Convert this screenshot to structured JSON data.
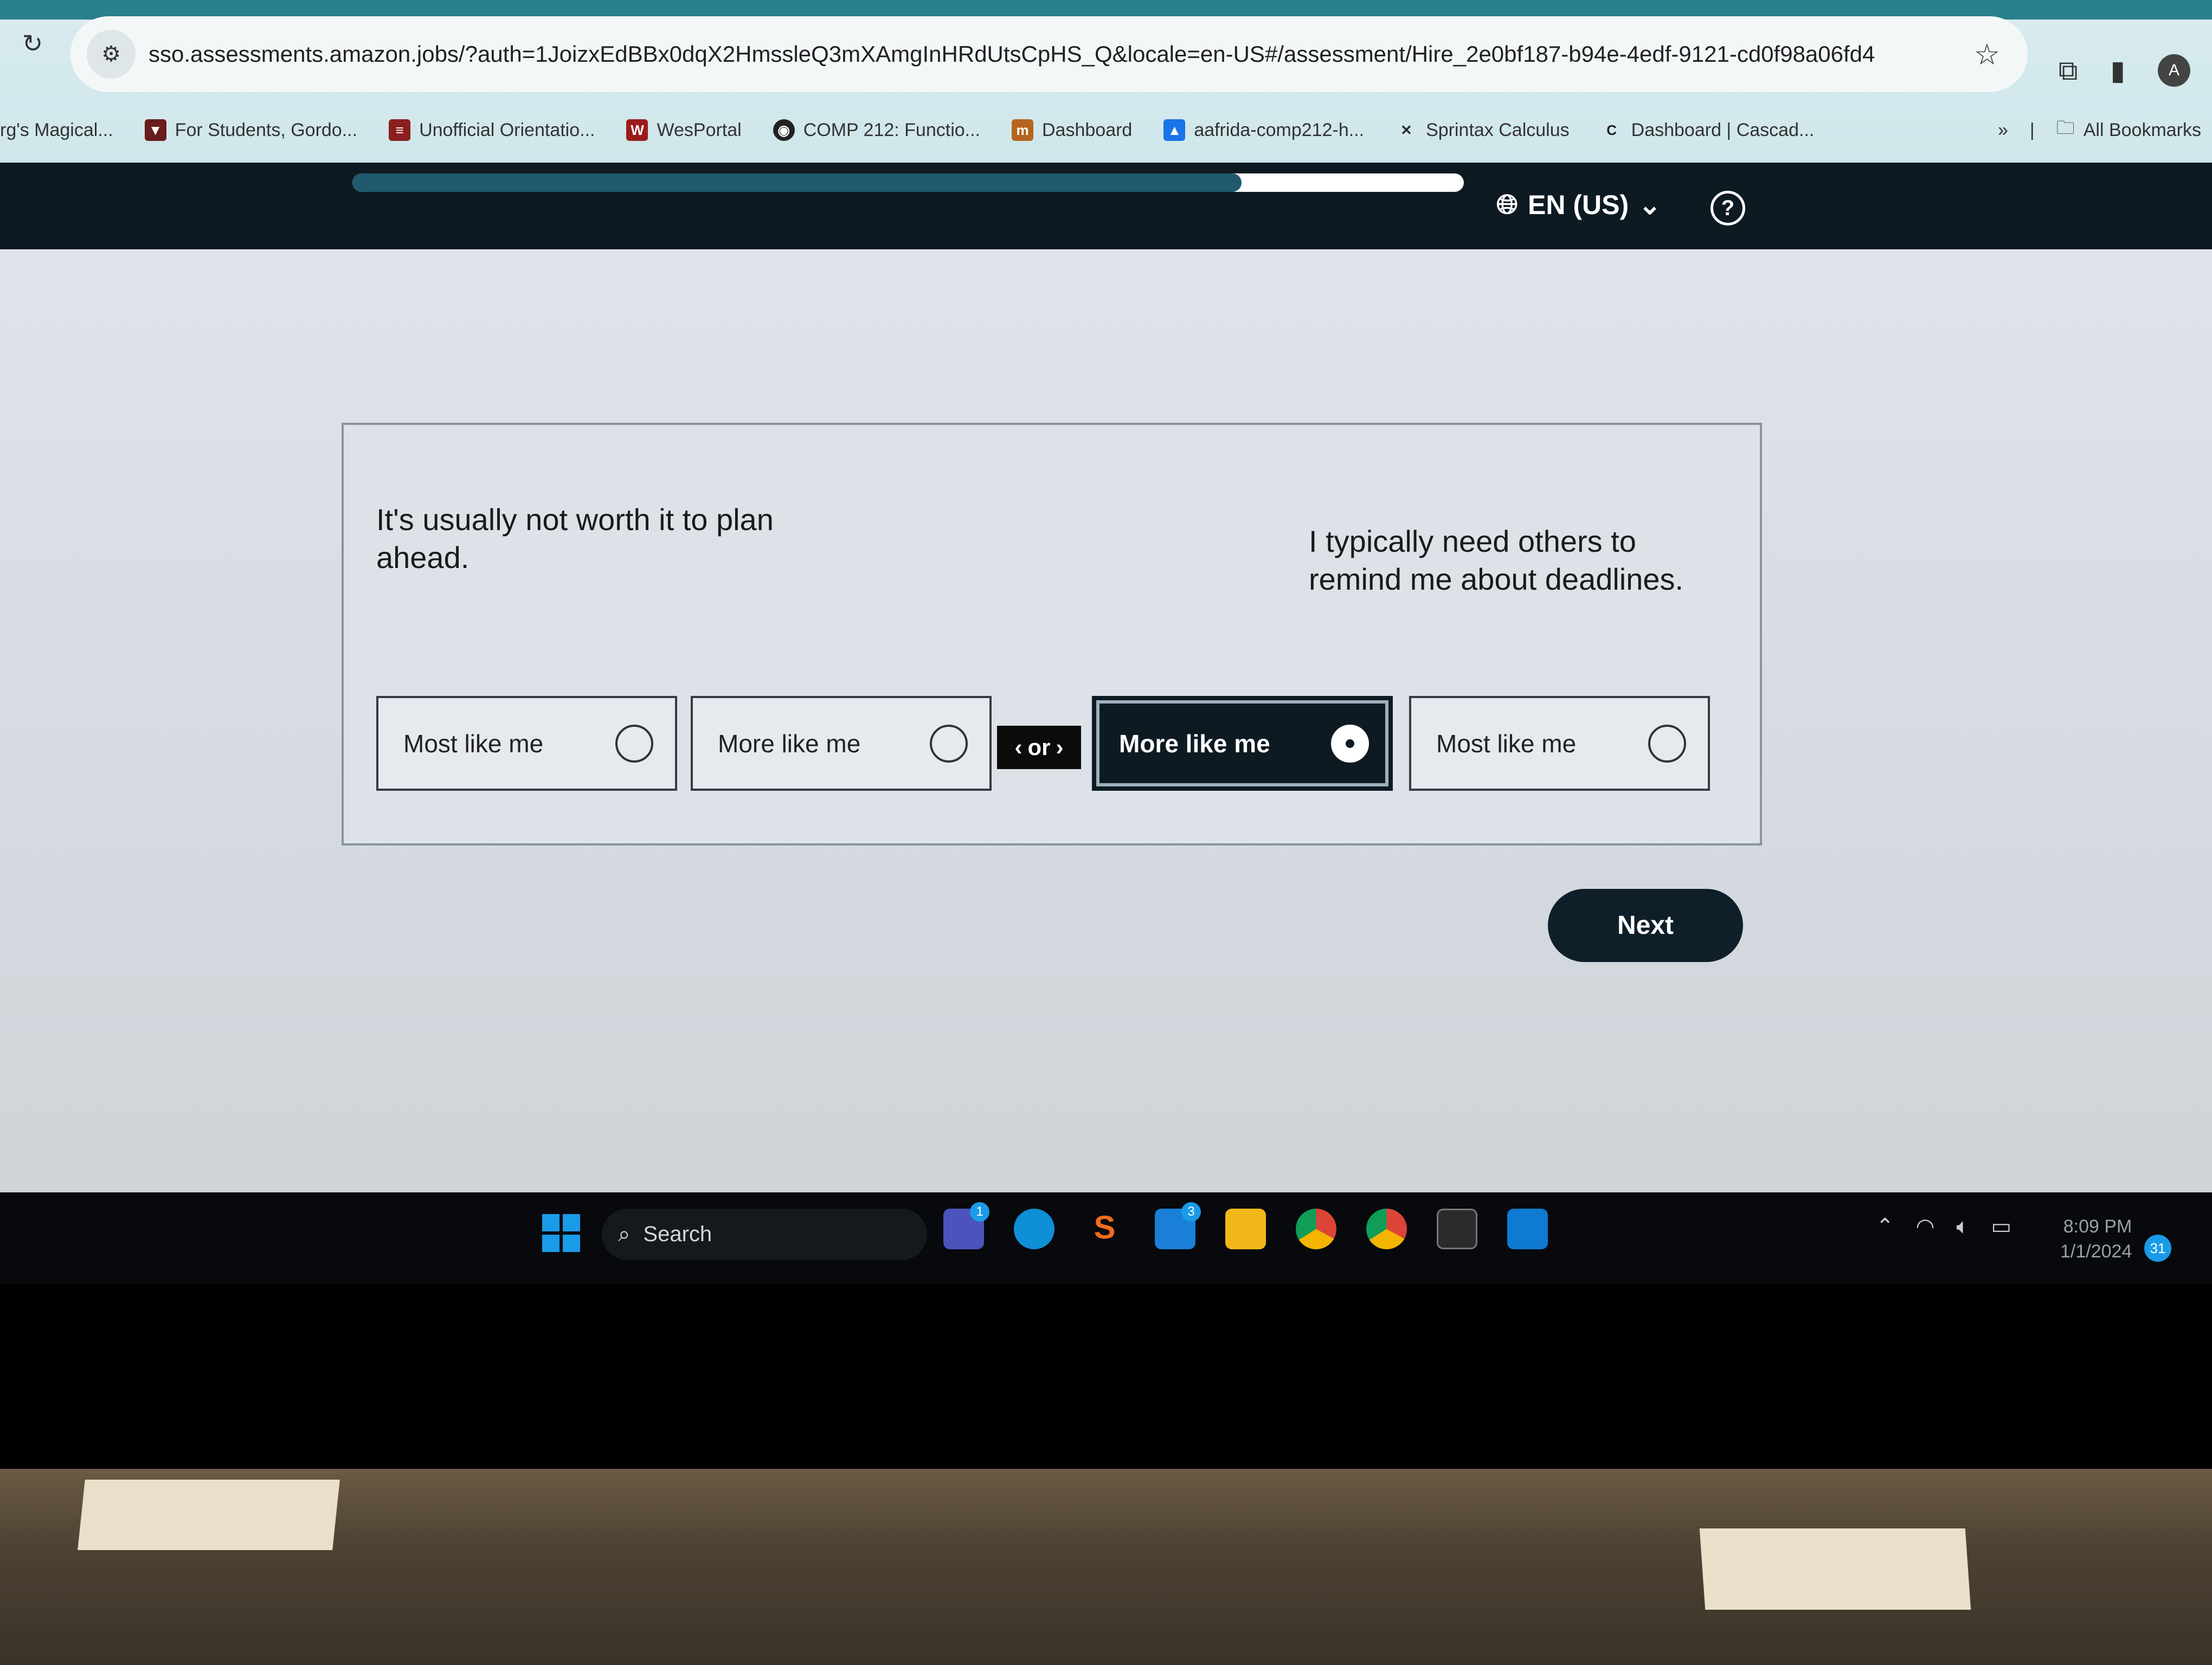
{
  "browser": {
    "url": "sso.assessments.amazon.jobs/?auth=1JoizxEdBBx0dqX2HmssleQ3mXAmgInHRdUtsCpHS_Q&locale=en-US#/assessment/Hire_2e0bf187-b94e-4edf-9121-cd0f98a06fd4",
    "bookmarks": [
      {
        "label": "rg's Magical...",
        "icon": "none"
      },
      {
        "label": "For Students, Gordo...",
        "icon": "shield-icon",
        "color": "#6a1b1b"
      },
      {
        "label": "Unofficial Orientatio...",
        "icon": "bookmark-icon",
        "color": "#8a1f1f"
      },
      {
        "label": "WesPortal",
        "icon": "w-logo-icon",
        "color": "#9b1b1b"
      },
      {
        "label": "COMP 212: Functio...",
        "icon": "globe-icon",
        "color": "#222222"
      },
      {
        "label": "Dashboard",
        "icon": "canvas-icon",
        "color": "#b5651d"
      },
      {
        "label": "aafrida-comp212-h...",
        "icon": "drive-icon",
        "color": "#1a73e8"
      },
      {
        "label": "Sprintax Calculus",
        "icon": "sprintax-icon",
        "color": "#2a2a2a"
      },
      {
        "label": "Dashboard | Cascad...",
        "icon": "cascade-icon",
        "color": "#222222"
      }
    ],
    "more_bookmarks": "»",
    "all_bookmarks_label": "All Bookmarks",
    "profile_initial": "A"
  },
  "header": {
    "progress": 0.8,
    "language": "EN (US)",
    "help_glyph": "?"
  },
  "question": {
    "left_statement": "It's usually not worth it to plan ahead.",
    "right_statement": "I typically need others to remind me about deadlines.",
    "options": [
      {
        "label": "Most like me",
        "selected": false
      },
      {
        "label": "More like me",
        "selected": false
      },
      {
        "label": "More like me",
        "selected": true
      },
      {
        "label": "Most like me",
        "selected": false
      }
    ],
    "separator": "or"
  },
  "actions": {
    "next_label": "Next"
  },
  "taskbar": {
    "search_label": "Search",
    "teams_badge": "1",
    "mail_badge": "3",
    "time": "8:09 PM",
    "date": "1/1/2024",
    "notifications": "31"
  },
  "colors": {
    "header_bg": "#0e1a22",
    "progress_fill": "#1f5a6e",
    "selected_option": "#0e1a22",
    "next_button": "#0f1f2a"
  }
}
